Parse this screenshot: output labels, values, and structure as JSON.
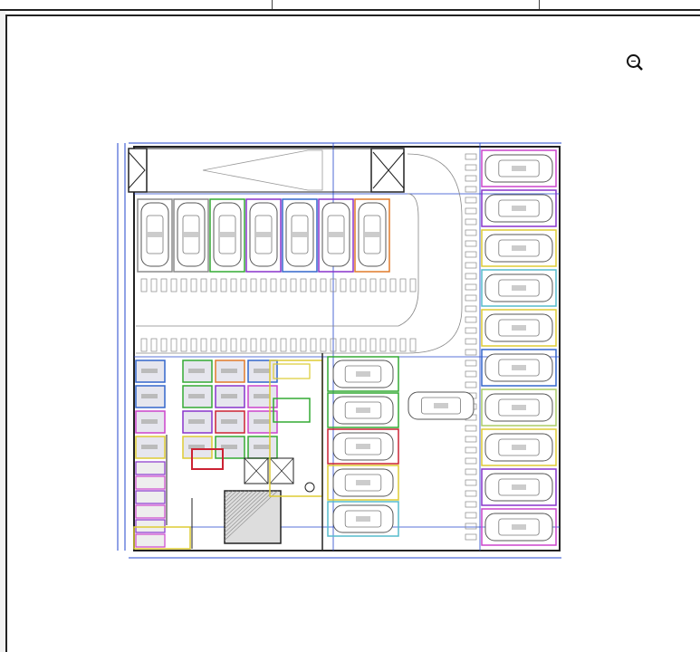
{
  "toolbar": {
    "zoom_icon": "zoom-icon"
  },
  "colors": {
    "dimension": "#2244cc",
    "wall": "#222222",
    "orange": "#e07a2a",
    "green": "#33aa33",
    "purple": "#8833cc",
    "blue": "#3366cc",
    "yellow": "#ddcc33",
    "magenta": "#cc44cc",
    "cyan": "#55bbcc",
    "red": "#cc2233",
    "olive": "#aacc66"
  },
  "plan": {
    "top_spots": [
      {
        "color": "#8a8a8a"
      },
      {
        "color": "#8a8a8a"
      },
      {
        "color": "#33aa33"
      },
      {
        "color": "#8833cc"
      },
      {
        "color": "#3366cc"
      },
      {
        "color": "#8833cc"
      },
      {
        "color": "#e07a2a"
      }
    ],
    "center_spots": [
      {
        "color": "#33aa33"
      },
      {
        "color": "#33aa33"
      },
      {
        "color": "#cc2233"
      },
      {
        "color": "#ddcc33"
      },
      {
        "color": "#55bbcc"
      }
    ],
    "right_spots": [
      {
        "color": "#cc44cc"
      },
      {
        "color": "#8833cc"
      },
      {
        "color": "#ddcc33"
      },
      {
        "color": "#55bbcc"
      },
      {
        "color": "#ddcc33"
      },
      {
        "color": "#3366cc"
      },
      {
        "color": "#aacc66"
      },
      {
        "color": "#ddcc33"
      },
      {
        "color": "#8833cc"
      },
      {
        "color": "#cc44cc"
      }
    ],
    "storage_units": [
      {
        "color": "#3366cc"
      },
      {
        "color": "#33aa33"
      },
      {
        "color": "#e07a2a"
      },
      {
        "color": "#3366cc"
      },
      {
        "color": "#3366cc"
      },
      {
        "color": "#33aa33"
      },
      {
        "color": "#8833cc"
      },
      {
        "color": "#cc44cc"
      },
      {
        "color": "#cc44cc"
      },
      {
        "color": "#8833cc"
      },
      {
        "color": "#cc2233"
      },
      {
        "color": "#cc44cc"
      },
      {
        "color": "#ddcc33"
      },
      {
        "color": "#ddcc33"
      },
      {
        "color": "#33aa33"
      },
      {
        "color": "#33aa33"
      }
    ]
  }
}
